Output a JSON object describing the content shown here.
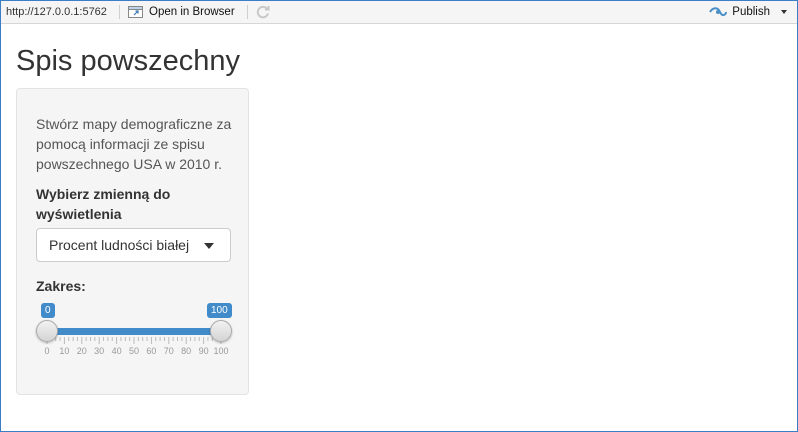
{
  "toolbar": {
    "url": "http://127.0.0.1:5762",
    "open_in_browser": "Open in Browser",
    "publish": "Publish",
    "icons": [
      "open-in-browser-icon",
      "refresh-icon",
      "publish-icon",
      "caret-down-icon"
    ]
  },
  "page": {
    "title": "Spis powszechny"
  },
  "sidebar": {
    "description": "Stwórz mapy demograficzne za pomocą informacji ze spisu powszechnego USA w 2010 r.",
    "select_label": "Wybierz zmienną do wyświetlenia",
    "select_value": "Procent ludności białej",
    "range_label": "Zakres:",
    "range": {
      "min": 0,
      "max": 100,
      "value_from": "0",
      "value_to": "100",
      "tick_labels": [
        "0",
        "10",
        "20",
        "30",
        "40",
        "50",
        "60",
        "70",
        "80",
        "90",
        "100"
      ]
    }
  },
  "colors": {
    "accent": "#428bca",
    "well_bg": "#f5f5f5"
  }
}
